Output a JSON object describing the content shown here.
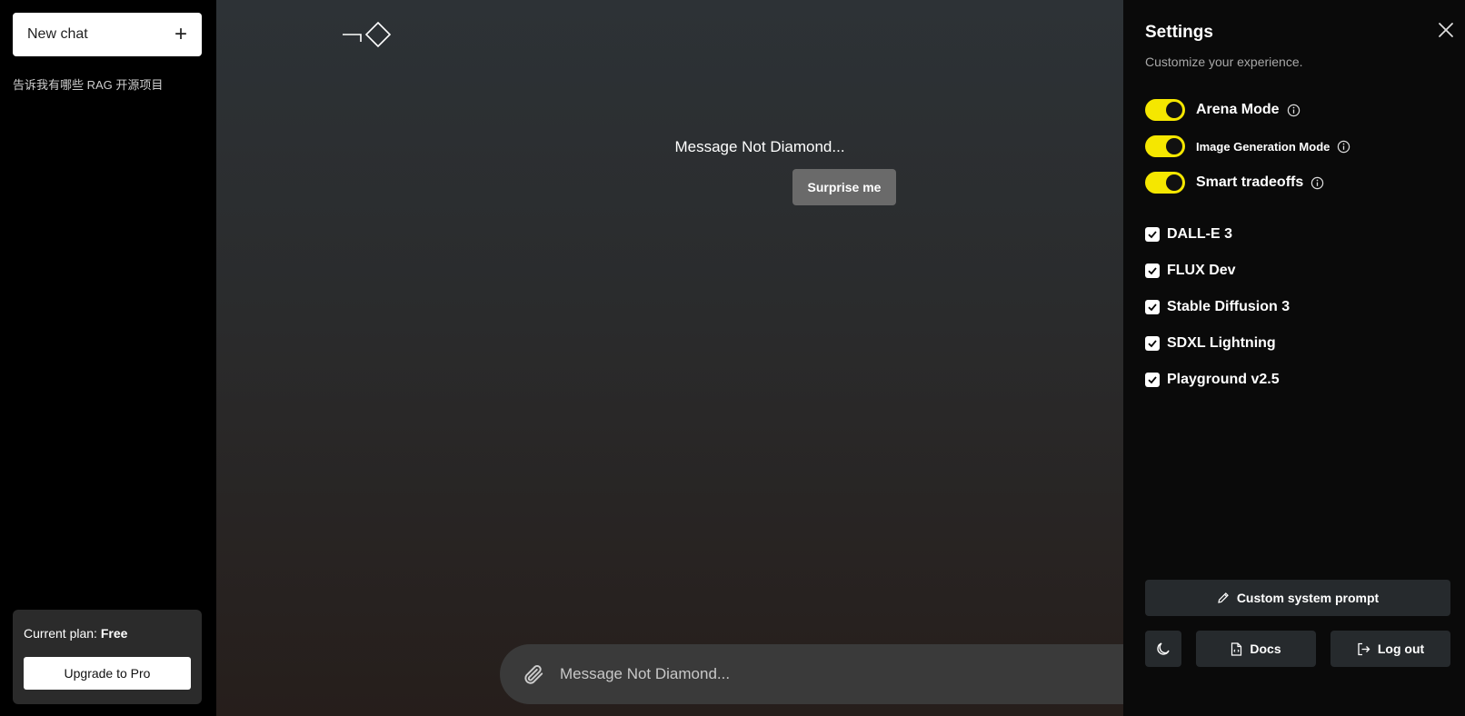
{
  "sidebar": {
    "new_chat_label": "New chat",
    "history": [
      {
        "label": "告诉我有哪些 RAG 开源项目"
      }
    ],
    "plan_label": "Current plan:",
    "plan_value": "Free",
    "upgrade_label": "Upgrade to Pro"
  },
  "main": {
    "prompt_title": "Message Not Diamond...",
    "surprise_label": "Surprise me",
    "input_placeholder": "Message Not Diamond..."
  },
  "settings": {
    "title": "Settings",
    "subtitle": "Customize your experience.",
    "toggles": [
      {
        "label": "Arena Mode",
        "on": true
      },
      {
        "label": "Image Generation Mode",
        "on": true
      },
      {
        "label": "Smart tradeoffs",
        "on": true
      }
    ],
    "models": [
      {
        "label": "DALL-E 3",
        "checked": true
      },
      {
        "label": "FLUX Dev",
        "checked": true
      },
      {
        "label": "Stable Diffusion 3",
        "checked": true
      },
      {
        "label": "SDXL Lightning",
        "checked": true
      },
      {
        "label": "Playground v2.5",
        "checked": true
      }
    ],
    "custom_prompt_label": "Custom system prompt",
    "docs_label": "Docs",
    "logout_label": "Log out"
  },
  "colors": {
    "toggle_accent": "#f5e700",
    "panel_bg": "#0a0a0a",
    "button_bg": "#262a2d"
  },
  "icons": [
    "plus-icon",
    "logo-icon",
    "paperclip-icon",
    "close-icon",
    "info-icon",
    "check-icon",
    "pencil-icon",
    "moon-icon",
    "doc-icon",
    "logout-icon"
  ]
}
